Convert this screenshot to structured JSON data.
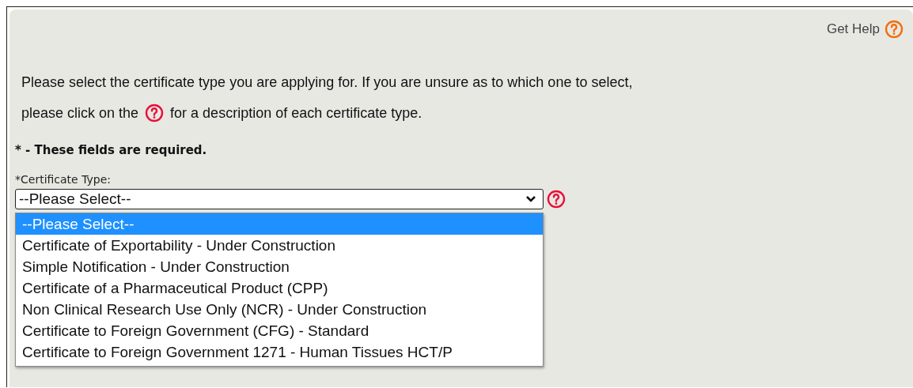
{
  "help_link": {
    "label": "Get Help"
  },
  "intro": {
    "line_1": "Please select the certificate type you are applying for. If you are unsure as to which one to select,",
    "line_2_before": "please click on the",
    "line_2_after": "for a description of each certificate type."
  },
  "required_note": "* - These fields are required.",
  "certificate_type": {
    "label": "*Certificate Type:",
    "value": "--Please Select--",
    "expanded": true,
    "options": [
      {
        "label": "--Please Select--",
        "selected": true
      },
      {
        "label": "Certificate of Exportability - Under Construction",
        "selected": false
      },
      {
        "label": "Simple Notification - Under Construction",
        "selected": false
      },
      {
        "label": "Certificate of a Pharmaceutical Product (CPP)",
        "selected": false
      },
      {
        "label": "Non Clinical Research Use Only (NCR) - Under Construction",
        "selected": false
      },
      {
        "label": "Certificate to Foreign Government (CFG) - Standard",
        "selected": false
      },
      {
        "label": "Certificate to Foreign Government 1271 - Human Tissues HCT/P",
        "selected": false
      }
    ]
  }
}
